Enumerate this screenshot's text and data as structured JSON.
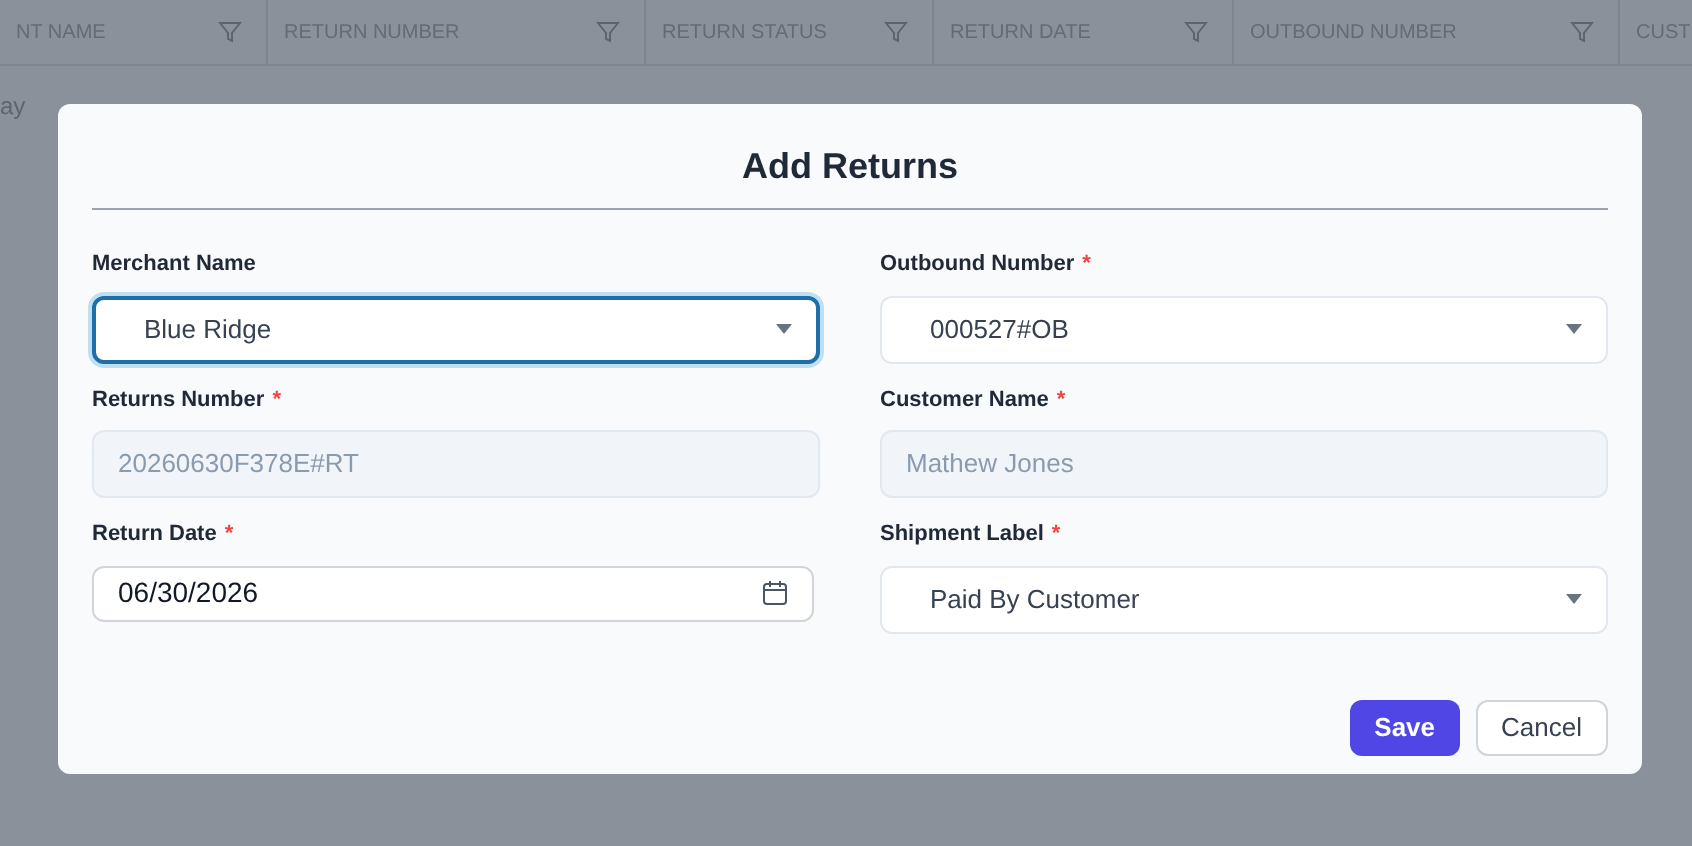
{
  "background_table": {
    "columns": [
      {
        "label": "NT NAME"
      },
      {
        "label": "RETURN NUMBER"
      },
      {
        "label": "RETURN STATUS"
      },
      {
        "label": "RETURN DATE"
      },
      {
        "label": "OUTBOUND NUMBER"
      },
      {
        "label": "CUST"
      }
    ],
    "column_1_cell": "ay"
  },
  "dialog": {
    "title": "Add Returns",
    "fields": [
      {
        "label": "Merchant Name",
        "kind": "select",
        "value": "Blue Ridge",
        "focused": true
      },
      {
        "label": "Outbound Number",
        "required_mark": "*",
        "kind": "select",
        "value": "000527#OB",
        "focused": false
      },
      {
        "label": "Returns Number",
        "required_mark": "*",
        "kind": "readonly",
        "value": "20260630F378E#RT",
        "focused": false
      },
      {
        "label": "Customer Name",
        "required_mark": "*",
        "kind": "readonly",
        "value": "Mathew Jones",
        "focused": false
      },
      {
        "label": "Return Date",
        "required_mark": "*",
        "kind": "date",
        "value": "06/30/2026",
        "focused": false
      },
      {
        "label": "Shipment Label",
        "required_mark": "*",
        "kind": "select",
        "value": "Paid By Customer",
        "focused": false
      }
    ],
    "buttons": [
      {
        "label": "Save",
        "kind": "primary"
      },
      {
        "label": "Cancel",
        "kind": "secondary"
      }
    ]
  }
}
